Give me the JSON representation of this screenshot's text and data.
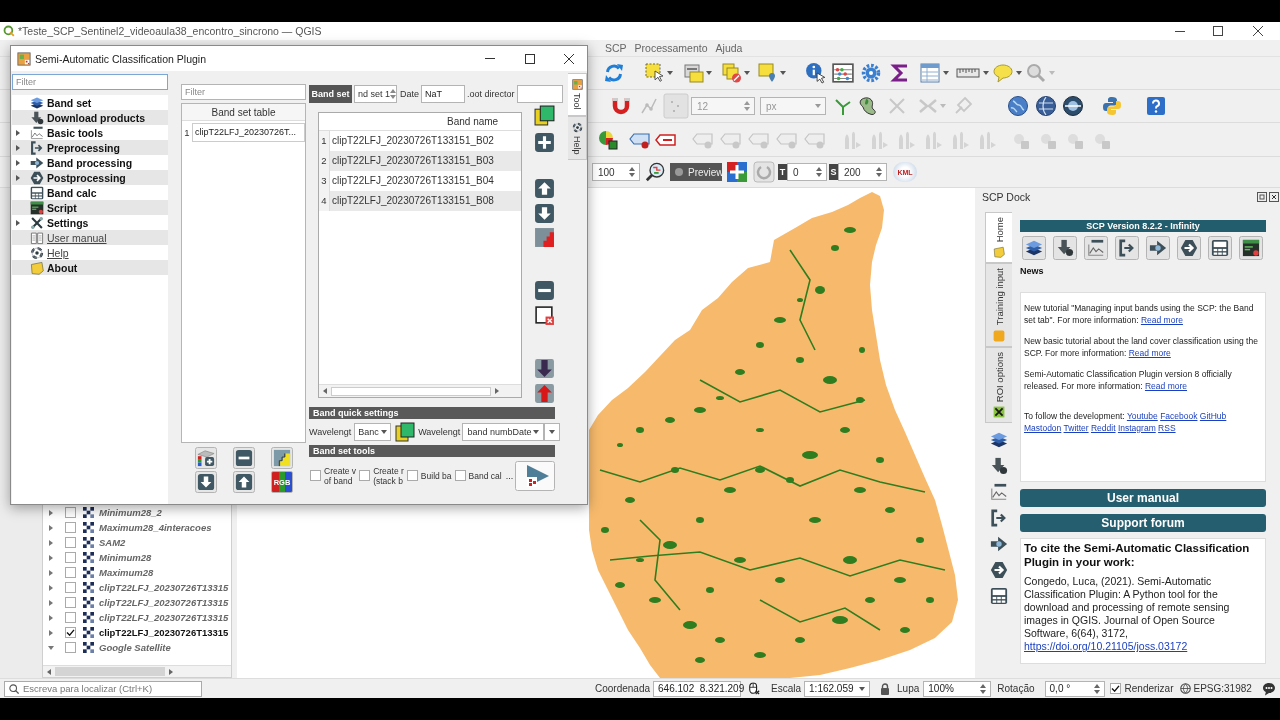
{
  "window": {
    "title": "*Teste_SCP_Sentinel2_videoaula38_encontro_sincrono — QGIS"
  },
  "menu": [
    {
      "label": "SCP"
    },
    {
      "label": "Processamento"
    },
    {
      "label": "Ajuda"
    }
  ],
  "toolbar": {
    "snapping_tolerance": "12",
    "snapping_unit": "px",
    "preview_size": "100",
    "preview_button": "Preview",
    "transparency_label": "T",
    "transparency": "0",
    "size_label": "S",
    "size": "200",
    "kml_button": "KML"
  },
  "dialog": {
    "title": "Semi-Automatic Classification Plugin",
    "filter_placeholder": "Filter",
    "tree": [
      {
        "label": "Band set",
        "kind": "tool",
        "expandable": false
      },
      {
        "label": "Download products",
        "kind": "tool",
        "expandable": false
      },
      {
        "label": "Basic tools",
        "kind": "tool",
        "expandable": true
      },
      {
        "label": "Preprocessing",
        "kind": "tool",
        "expandable": true
      },
      {
        "label": "Band processing",
        "kind": "tool",
        "expandable": true
      },
      {
        "label": "Postprocessing",
        "kind": "tool",
        "expandable": true
      },
      {
        "label": "Band calc",
        "kind": "tool",
        "expandable": false
      },
      {
        "label": "Script",
        "kind": "tool",
        "expandable": false
      },
      {
        "label": "Settings",
        "kind": "tool",
        "expandable": true
      },
      {
        "label": "User manual",
        "kind": "link",
        "expandable": false
      },
      {
        "label": "Help",
        "kind": "link",
        "expandable": false
      },
      {
        "label": "About",
        "kind": "tool",
        "expandable": false
      }
    ],
    "band_set_filter_placeholder": "Filter",
    "band_set_table": {
      "header": "Band set table",
      "rows": [
        {
          "number": "1",
          "name": "clipT22LFJ_20230726T..."
        }
      ]
    },
    "rgb_button": "RGB",
    "band_set_label": "Band set",
    "band_set_number": "nd set 1",
    "date_label": "Date",
    "date": "NaT",
    "root_directory_label": ".oot director",
    "band_table": {
      "header": "Band name",
      "rows": [
        {
          "number": "1",
          "name": "clipT22LFJ_20230726T133151_B02"
        },
        {
          "number": "2",
          "name": "clipT22LFJ_20230726T133151_B03"
        },
        {
          "number": "3",
          "name": "clipT22LFJ_20230726T133151_B04"
        },
        {
          "number": "4",
          "name": "clipT22LFJ_20230726T133151_B08"
        }
      ]
    },
    "quick_settings": {
      "title": "Band quick settings",
      "wavelength_label": "Wavelengt",
      "wavelength": "Banc",
      "unit_label": "Wavelengt",
      "unit": "band numbDate"
    },
    "tools": {
      "title": "Band set tools",
      "options": [
        {
          "label": "Create v\nof band",
          "checked": false
        },
        {
          "label": "Create r\n(stack b",
          "checked": false
        },
        {
          "label": "Build ba",
          "checked": false
        },
        {
          "label": "Band cal",
          "checked": false
        }
      ],
      "more": "..."
    },
    "tabs": [
      {
        "label": "Tool",
        "selected": true
      },
      {
        "label": "Help",
        "selected": false
      }
    ]
  },
  "layers": [
    {
      "name": "Minimum28_2",
      "checked": false,
      "expanded": false
    },
    {
      "name": "Maximum28_4interacoes",
      "checked": false,
      "expanded": false
    },
    {
      "name": "SAM2",
      "checked": false,
      "expanded": false
    },
    {
      "name": "Minimum28",
      "checked": false,
      "expanded": false
    },
    {
      "name": "Maximum28",
      "checked": false,
      "expanded": false
    },
    {
      "name": "clipT22LFJ_20230726T13315",
      "checked": false,
      "expanded": false
    },
    {
      "name": "clipT22LFJ_20230726T13315",
      "checked": false,
      "expanded": false
    },
    {
      "name": "clipT22LFJ_20230726T13315",
      "checked": false,
      "expanded": false
    },
    {
      "name": "clipT22LFJ_20230726T13315",
      "checked": true,
      "expanded": false
    },
    {
      "name": "Google Satellite",
      "checked": false,
      "expanded": true
    }
  ],
  "scp_dock": {
    "title": "SCP Dock",
    "tabs": [
      {
        "label": "Home",
        "selected": true
      },
      {
        "label": "Training input",
        "selected": false
      },
      {
        "label": "ROI options",
        "selected": false
      }
    ],
    "version": "SCP Version 8.2.2 - Infinity",
    "news_title": "News",
    "news": [
      {
        "text": "New tutorial \"Managing input bands using the SCP: the Band set tab\". For more information:",
        "links": [
          "Read more"
        ]
      },
      {
        "text": "New basic tutorial about the land cover classification using the SCP. For more information:",
        "links": [
          "Read more"
        ]
      },
      {
        "text": "Semi-Automatic Classification Plugin version 8 officially released. For more information:",
        "links": [
          "Read more"
        ]
      },
      {
        "text": "To follow the development:",
        "links": [
          "Youtube",
          "Facebook",
          "GitHub",
          "Mastodon",
          "Twitter",
          "Reddit",
          "Instagram",
          "RSS"
        ]
      }
    ],
    "buttons": [
      {
        "label": "User manual"
      },
      {
        "label": "Support forum"
      }
    ],
    "cite_title": "To cite the Semi-Automatic Classification Plugin in your work:",
    "cite_text": "Congedo, Luca, (2021). Semi-Automatic Classification Plugin: A Python tool for the download and processing of remote sensing images in QGIS. Journal of Open Source Software, 6(64), 3172,",
    "cite_link": "https://doi.org/10.21105/joss.03172"
  },
  "status_bar": {
    "search_placeholder": "Escreva para localizar (Ctrl+K)",
    "coordinate_label": "Coordenada",
    "coordinate": "646.102  8.321.209",
    "scale_label": "Escala",
    "scale": "1:162.059",
    "magnifier_label": "Lupa",
    "magnifier": "100%",
    "rotation_label": "Rotação",
    "rotation": "0,0 °",
    "render_label": "Renderizar",
    "render": true,
    "crs": "EPSG:31982"
  }
}
